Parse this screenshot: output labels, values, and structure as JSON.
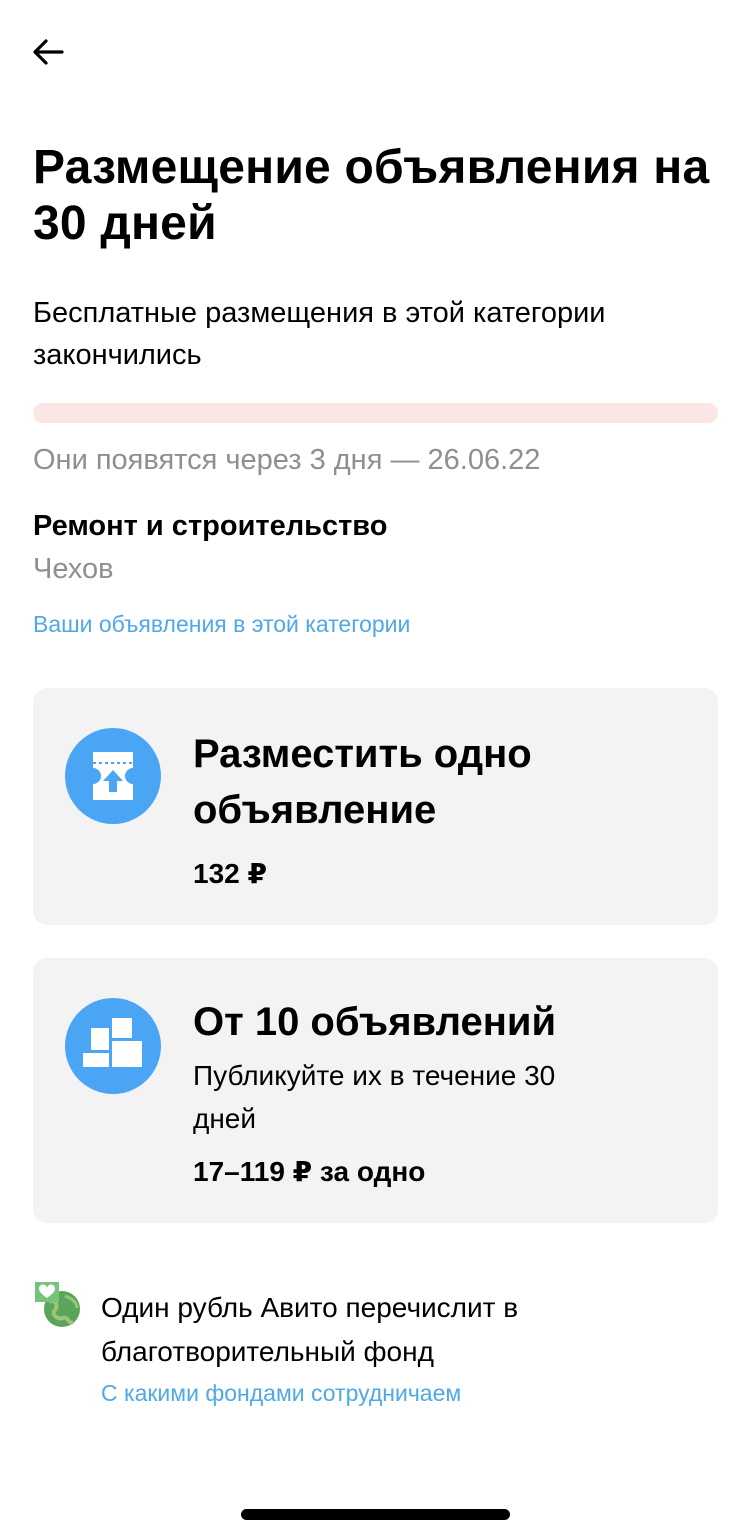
{
  "header": {
    "back_icon": "arrow-left-icon",
    "title": "Размещение объявления на 30 дней"
  },
  "status": {
    "subtitle": "Бесплатные размещения в этой категории закончились",
    "progress_fraction": 0,
    "progress_color": "#fbe5e5",
    "appear_text": "Они появятся через 3 дня — 26.06.22"
  },
  "category": {
    "name": "Ремонт и строительство",
    "city": "Чехов",
    "link": "Ваши объявления в этой категории"
  },
  "options": [
    {
      "icon": "ticket-upload-icon",
      "title": "Разместить одно объявление",
      "price": "132 ₽"
    },
    {
      "icon": "package-boxes-icon",
      "title": "От 10 объявлений",
      "description": "Публикуйте их в течение 30 дней",
      "price": "17–119 ₽ за одно"
    }
  ],
  "charity": {
    "icon": "charity-globe-heart-icon",
    "text": "Один рубль Авито перечислит в благотворительный фонд",
    "link": "С какими фондами сотрудничаем"
  },
  "colors": {
    "accent_blue": "#4aa6f5",
    "link_blue": "#4fa8e8",
    "muted_gray": "#8f8f8f",
    "card_bg": "#f3f3f3"
  }
}
